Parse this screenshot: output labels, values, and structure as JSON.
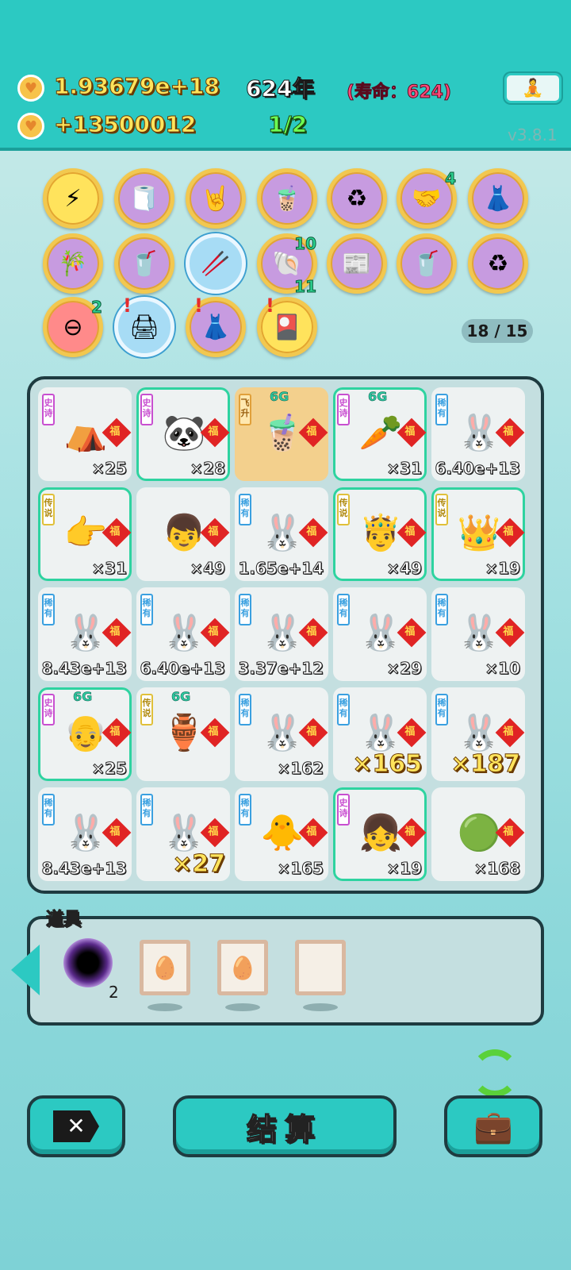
{
  "header": {
    "gold": "1.93679e+18",
    "income": "+13500012",
    "year": "624年",
    "lifespan": "(寿命：624)",
    "wave": "1/2",
    "version": "v3.8.1"
  },
  "skills": [
    {
      "icon": "lightning-icon",
      "glyph": "⚡",
      "style": "yel",
      "count": ""
    },
    {
      "icon": "tissue-box-icon",
      "glyph": "🧻",
      "style": "",
      "count": ""
    },
    {
      "icon": "rock-hand-icon",
      "glyph": "🤘",
      "style": "",
      "count": ""
    },
    {
      "icon": "milk-tea-icon",
      "glyph": "🧋",
      "style": "",
      "count": ""
    },
    {
      "icon": "recycle-icon",
      "glyph": "♻",
      "style": "",
      "count": ""
    },
    {
      "icon": "handshake-icon",
      "glyph": "🤝",
      "style": "",
      "count": "4"
    },
    {
      "icon": "skirt-icon",
      "glyph": "👗",
      "style": "",
      "count": ""
    },
    {
      "icon": "bamboo-icon",
      "glyph": "🎋",
      "style": "",
      "count": ""
    },
    {
      "icon": "cup-plus-icon",
      "glyph": "🥤",
      "style": "",
      "count": ""
    },
    {
      "icon": "chopsticks-icon",
      "glyph": "🥢",
      "style": "blue",
      "count": ""
    },
    {
      "icon": "shell-icon",
      "glyph": "🐚",
      "style": "",
      "count": "10"
    },
    {
      "icon": "time-magazine-icon",
      "glyph": "📰",
      "style": "",
      "count": ""
    },
    {
      "icon": "cup-plus-icon-2",
      "glyph": "🥤",
      "style": "",
      "count": ""
    },
    {
      "icon": "recycle-icon-2",
      "glyph": "♻",
      "style": "",
      "count": ""
    },
    {
      "icon": "minus-icon",
      "glyph": "⊖",
      "style": "red",
      "count": "2"
    },
    {
      "icon": "printer-icon",
      "glyph": "🖨",
      "style": "blue",
      "count": ""
    },
    {
      "icon": "skirt-icon-2",
      "glyph": "👗",
      "style": "",
      "count": ""
    },
    {
      "icon": "card-pack-icon",
      "glyph": "🎴",
      "style": "yel",
      "count": ""
    }
  ],
  "shell_sub_count": "11",
  "capacity": "18 / 15",
  "board": [
    {
      "tag": "史诗",
      "tagClass": "e",
      "g6": "",
      "fu": true,
      "glyph": "⛺",
      "icon": "tent-icon",
      "qty": "×25",
      "big": false,
      "cls": ""
    },
    {
      "tag": "史诗",
      "tagClass": "e",
      "g6": "",
      "fu": true,
      "glyph": "🐼",
      "icon": "panda-icon",
      "qty": "×28",
      "big": false,
      "cls": "epic"
    },
    {
      "tag": "飞升",
      "tagClass": "f",
      "g6": "6G",
      "fu": true,
      "glyph": "🧋",
      "icon": "milk-tea-icon",
      "qty": "",
      "big": false,
      "cls": "gold"
    },
    {
      "tag": "史诗",
      "tagClass": "e",
      "g6": "6G",
      "fu": true,
      "glyph": "🥕",
      "icon": "carrot-icon",
      "qty": "×31",
      "big": false,
      "cls": "epic"
    },
    {
      "tag": "稀有",
      "tagClass": "r",
      "g6": "",
      "fu": true,
      "glyph": "🐰",
      "icon": "rabbit-icon",
      "qty": "6.40e+13",
      "big": false,
      "cls": ""
    },
    {
      "tag": "传说",
      "tagClass": "l",
      "g6": "",
      "fu": true,
      "glyph": "👉",
      "icon": "pointing-hand-icon",
      "qty": "×31",
      "big": false,
      "cls": "epic"
    },
    {
      "tag": "",
      "tagClass": "",
      "g6": "",
      "fu": true,
      "glyph": "👦",
      "icon": "boy-face-icon",
      "qty": "×49",
      "big": false,
      "cls": ""
    },
    {
      "tag": "稀有",
      "tagClass": "r",
      "g6": "",
      "fu": true,
      "glyph": "🐰",
      "icon": "rabbit-icon",
      "qty": "1.65e+14",
      "big": false,
      "cls": ""
    },
    {
      "tag": "传说",
      "tagClass": "l",
      "g6": "",
      "fu": true,
      "glyph": "🤴",
      "icon": "king-face-icon",
      "qty": "×49",
      "big": false,
      "cls": "epic"
    },
    {
      "tag": "传说",
      "tagClass": "l",
      "g6": "",
      "fu": true,
      "glyph": "👑",
      "icon": "crowned-hand-icon",
      "qty": "×19",
      "big": false,
      "cls": "epic"
    },
    {
      "tag": "稀有",
      "tagClass": "r",
      "g6": "",
      "fu": true,
      "glyph": "🐰",
      "icon": "rabbit-icon",
      "qty": "8.43e+13",
      "big": false,
      "cls": ""
    },
    {
      "tag": "稀有",
      "tagClass": "r",
      "g6": "",
      "fu": true,
      "glyph": "🐰",
      "icon": "rabbit-icon",
      "qty": "6.40e+13",
      "big": false,
      "cls": ""
    },
    {
      "tag": "稀有",
      "tagClass": "r",
      "g6": "",
      "fu": true,
      "glyph": "🐰",
      "icon": "rabbit-icon",
      "qty": "3.37e+12",
      "big": false,
      "cls": ""
    },
    {
      "tag": "稀有",
      "tagClass": "r",
      "g6": "",
      "fu": true,
      "glyph": "🐰",
      "icon": "rabbit-icon",
      "qty": "×29",
      "big": false,
      "cls": ""
    },
    {
      "tag": "稀有",
      "tagClass": "r",
      "g6": "",
      "fu": true,
      "glyph": "🐰",
      "icon": "rabbit-icon",
      "qty": "×10",
      "big": false,
      "cls": ""
    },
    {
      "tag": "史诗",
      "tagClass": "e",
      "g6": "6G",
      "fu": true,
      "glyph": "👴",
      "icon": "old-man-icon",
      "qty": "×25",
      "big": false,
      "cls": "epic"
    },
    {
      "tag": "传说",
      "tagClass": "l",
      "g6": "6G",
      "fu": true,
      "glyph": "🏺",
      "icon": "green-vase-icon",
      "qty": "",
      "big": false,
      "cls": ""
    },
    {
      "tag": "稀有",
      "tagClass": "r",
      "g6": "",
      "fu": true,
      "glyph": "🐰",
      "icon": "rabbit-icon",
      "qty": "×162",
      "big": false,
      "cls": ""
    },
    {
      "tag": "稀有",
      "tagClass": "r",
      "g6": "",
      "fu": true,
      "glyph": "🐰",
      "icon": "rabbit-icon",
      "qty": "×165",
      "big": true,
      "cls": ""
    },
    {
      "tag": "稀有",
      "tagClass": "r",
      "g6": "",
      "fu": true,
      "glyph": "🐰",
      "icon": "rabbit-icon",
      "qty": "×187",
      "big": true,
      "cls": ""
    },
    {
      "tag": "稀有",
      "tagClass": "r",
      "g6": "",
      "fu": true,
      "glyph": "🐰",
      "icon": "rabbit-icon",
      "qty": "8.43e+13",
      "big": false,
      "cls": ""
    },
    {
      "tag": "稀有",
      "tagClass": "r",
      "g6": "",
      "fu": true,
      "glyph": "🐰",
      "icon": "rabbit-icon",
      "qty": "×27",
      "big": true,
      "cls": ""
    },
    {
      "tag": "稀有",
      "tagClass": "r",
      "g6": "",
      "fu": true,
      "glyph": "🐥",
      "icon": "chick-icon",
      "qty": "×165",
      "big": false,
      "cls": ""
    },
    {
      "tag": "史诗",
      "tagClass": "e",
      "g6": "",
      "fu": true,
      "glyph": "👧",
      "icon": "girl-face-icon",
      "qty": "×19",
      "big": false,
      "cls": "epic"
    },
    {
      "tag": "",
      "tagClass": "",
      "g6": "",
      "fu": true,
      "glyph": "🟢",
      "icon": "green-orb-icon",
      "qty": "×168",
      "big": false,
      "cls": ""
    }
  ],
  "tray": {
    "title": "道具",
    "blackhole_count": "2",
    "items": [
      {
        "icon": "egg-icon",
        "glyph": "🥚"
      },
      {
        "icon": "egg-icon",
        "glyph": "🥚"
      },
      {
        "icon": "empty-frame-icon",
        "glyph": ""
      }
    ]
  },
  "buttons": {
    "settle": "结算"
  },
  "colors": {
    "accent": "#2cc9c2",
    "gold_text": "#ffe45c"
  }
}
